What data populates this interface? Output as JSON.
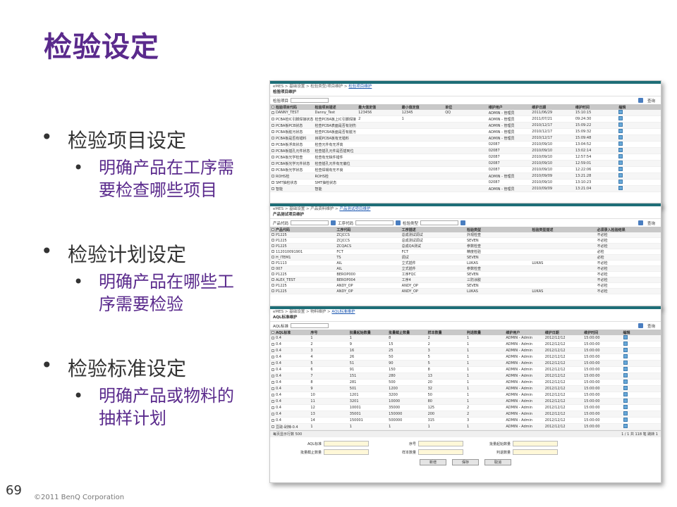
{
  "slide": {
    "title": "检验设定",
    "page_number": "69",
    "copyright": "©2011 BenQ Corporation"
  },
  "bullets": [
    {
      "label": "检验项目设定",
      "sub_lines": [
        "明确产品在工序需",
        "要检查哪些项目"
      ]
    },
    {
      "label": "检验计划设定",
      "sub_lines": [
        "明确产品在哪些工",
        "序需要检验"
      ]
    },
    {
      "label": "检验标准设定",
      "sub_lines": [
        "明确产品或物料的",
        "抽样计划"
      ]
    }
  ],
  "panel1": {
    "breadcrumb": "eMES > 基础设置 > 检验类型/项目维护 >",
    "breadcrumb_link": "检验项目维护",
    "title": "检验项目维护",
    "filter_label": "检验项目",
    "query_label": "查询",
    "columns": [
      "检验项目代码",
      "检验项目描述",
      "最大值定值",
      "最小值定值",
      "单位",
      "维护用户",
      "维护日期",
      "维护时间",
      "编辑"
    ],
    "rows": [
      [
        "DANNY_TEST",
        "Danny_Test",
        "123456",
        "12345",
        "QQ",
        "ADMIN - 管理员",
        "2011/06/29",
        "15:10:15"
      ],
      [
        "PCBA检IC引脚焊接状态",
        "检查PCBA板上IC引脚焊接",
        "2",
        "1",
        "",
        "ADMIN - 管理员",
        "2011/07/21",
        "09:24:30"
      ],
      [
        "PCBA板PCB状态",
        "检查PCBA表面是否有划伤",
        "",
        "",
        "",
        "ADMIN - 管理员",
        "2010/12/17",
        "15:09:22"
      ],
      [
        "PCBA板脏污状态",
        "检查PCBA板面是否有脏污",
        "",
        "",
        "",
        "ADMIN - 管理员",
        "2010/12/17",
        "15:09:32"
      ],
      [
        "PCBA板是否有错料",
        "目视PCBA板有无错料",
        "",
        "",
        "",
        "ADMIN - 管理员",
        "2010/12/17",
        "15:09:48"
      ],
      [
        "PCBA板浮高状态",
        "检查元件有无浮高",
        "",
        "",
        "",
        "02087",
        "2010/09/10",
        "13:04:52"
      ],
      [
        "PCBA板插孔元件状态",
        "检查插孔元件是否插到位",
        "",
        "",
        "",
        "02087",
        "2010/09/10",
        "13:02:14"
      ],
      [
        "PCBA板光学检查",
        "检查有无缺件错件",
        "",
        "",
        "",
        "02087",
        "2010/09/10",
        "12:57:54"
      ],
      [
        "PCBA板光学元件状态",
        "检查插孔元件有无偏位",
        "",
        "",
        "",
        "02087",
        "2010/09/10",
        "12:59:01"
      ],
      [
        "PCBA板光学状态",
        "检查焊锡有无不良",
        "",
        "",
        "",
        "02087",
        "2010/09/10",
        "12:22:06"
      ],
      [
        "ROHS检",
        "ROHS检",
        "",
        "",
        "",
        "ADMIN - 管理员",
        "2010/09/09",
        "13:21:28"
      ],
      [
        "SMT抽检状态",
        "SMT抽检状态",
        "",
        "",
        "",
        "02087",
        "2010/09/10",
        "13:10:23"
      ],
      [
        "智能",
        "智能",
        "",
        "",
        "",
        "ADMIN - 管理员",
        "2010/09/09",
        "13:21:04"
      ]
    ]
  },
  "panel2": {
    "breadcrumb": "eMES > 基础设置 > 产品资料维护 >",
    "breadcrumb_link": "产品测试项目维护",
    "title": "产品测试项目维护",
    "filter_labels": [
      "产品代码",
      "工序代码",
      "检验类型"
    ],
    "query_label": "查询",
    "columns": [
      "产品代码",
      "工序代码",
      "工序描述",
      "检验类型",
      "检验类型描述",
      "必须录入检验结果"
    ],
    "rows": [
      [
        "P1225",
        "ZCJCCS",
        "总成测试调试",
        "外观检查",
        "",
        "不必检"
      ],
      [
        "P1225",
        "ZCJCCS",
        "总成测试调试",
        "SEVEN",
        "",
        "不必检"
      ],
      [
        "P1225",
        "ZCQACS",
        "总成QA测试",
        "参数检查",
        "",
        "不必检"
      ],
      [
        "112010091901",
        "FCT",
        "FCT",
        "精度检验",
        "",
        "必检"
      ],
      [
        "H_ITEM1",
        "TS",
        "调试",
        "SEVEN",
        "",
        "必检"
      ],
      [
        "P1113",
        "AIL",
        "立式插件",
        "LUKAS",
        "LUKAS",
        "不必检"
      ],
      [
        "007",
        "AIL",
        "立式插件",
        "参数检查",
        "",
        "不必检"
      ],
      [
        "P1225",
        "BEROP000",
        "工序FQC",
        "SEVEN",
        "",
        "不必检"
      ],
      [
        "ALEX_TEST",
        "BEROP004",
        "工序4",
        "三防涂胶",
        "",
        "不必检"
      ],
      [
        "P1225",
        "ANDY_OP",
        "ANDY_OP",
        "SEVEN",
        "",
        "不必检"
      ],
      [
        "P1225",
        "ANDY_OP",
        "ANDY_OP",
        "LUKAS",
        "LUKAS",
        "不必检"
      ]
    ]
  },
  "panel3": {
    "breadcrumb": "eMES > 基础设置 > 物料维护 >",
    "breadcrumb_link": "AQL标准维护",
    "title": "AQL标准维护",
    "filter_label": "AQL标准",
    "query_label": "查询",
    "columns": [
      "AQL标准",
      "序号",
      "批量起始数量",
      "批量截止数量",
      "样本数量",
      "判退数量",
      "维护用户",
      "维护日期",
      "维护时间",
      "编辑"
    ],
    "rows": [
      [
        "0.4",
        "1",
        "1",
        "8",
        "2",
        "1",
        "ADMIN - Admin",
        "2012/12/12",
        "15:00:00"
      ],
      [
        "0.4",
        "2",
        "9",
        "15",
        "2",
        "1",
        "ADMIN - Admin",
        "2012/12/12",
        "15:00:00"
      ],
      [
        "0.4",
        "3",
        "16",
        "25",
        "3",
        "1",
        "ADMIN - Admin",
        "2012/12/12",
        "15:00:00"
      ],
      [
        "0.4",
        "4",
        "26",
        "50",
        "5",
        "1",
        "ADMIN - Admin",
        "2012/12/12",
        "15:00:00"
      ],
      [
        "0.4",
        "5",
        "51",
        "90",
        "5",
        "1",
        "ADMIN - Admin",
        "2012/12/12",
        "15:00:00"
      ],
      [
        "0.4",
        "6",
        "91",
        "150",
        "8",
        "1",
        "ADMIN - Admin",
        "2012/12/12",
        "15:00:00"
      ],
      [
        "0.4",
        "7",
        "151",
        "280",
        "13",
        "1",
        "ADMIN - Admin",
        "2012/12/12",
        "15:00:00"
      ],
      [
        "0.4",
        "8",
        "281",
        "500",
        "20",
        "1",
        "ADMIN - Admin",
        "2012/12/12",
        "15:00:00"
      ],
      [
        "0.4",
        "9",
        "501",
        "1200",
        "32",
        "1",
        "ADMIN - Admin",
        "2012/12/12",
        "15:00:00"
      ],
      [
        "0.4",
        "10",
        "1201",
        "3200",
        "50",
        "1",
        "ADMIN - Admin",
        "2012/12/12",
        "15:00:00"
      ],
      [
        "0.4",
        "11",
        "3201",
        "10000",
        "80",
        "1",
        "ADMIN - Admin",
        "2012/12/12",
        "15:00:00"
      ],
      [
        "0.4",
        "12",
        "10001",
        "35000",
        "125",
        "2",
        "ADMIN - Admin",
        "2012/12/12",
        "15:00:00"
      ],
      [
        "0.4",
        "13",
        "35001",
        "150000",
        "200",
        "2",
        "ADMIN - Admin",
        "2012/12/12",
        "15:00:00"
      ],
      [
        "0.4",
        "14",
        "150001",
        "500000",
        "315",
        "3",
        "ADMIN - Admin",
        "2012/12/12",
        "15:00:00"
      ],
      [
        "豆豉-剁辣-0.4",
        "1",
        "1",
        "1",
        "1",
        "1",
        "ADMIN - Admin",
        "2012/12/12",
        "15:00:00"
      ]
    ],
    "pager_left": "每页显示行数 500",
    "pager_right": "1 / 1 共 118 笔 跳转 1",
    "form_labels": [
      "AQL标准",
      "序号",
      "批量起始数量",
      "批量截止数量",
      "样本数量",
      "判退数量"
    ],
    "buttons": [
      "新增",
      "保存",
      "取消"
    ]
  }
}
